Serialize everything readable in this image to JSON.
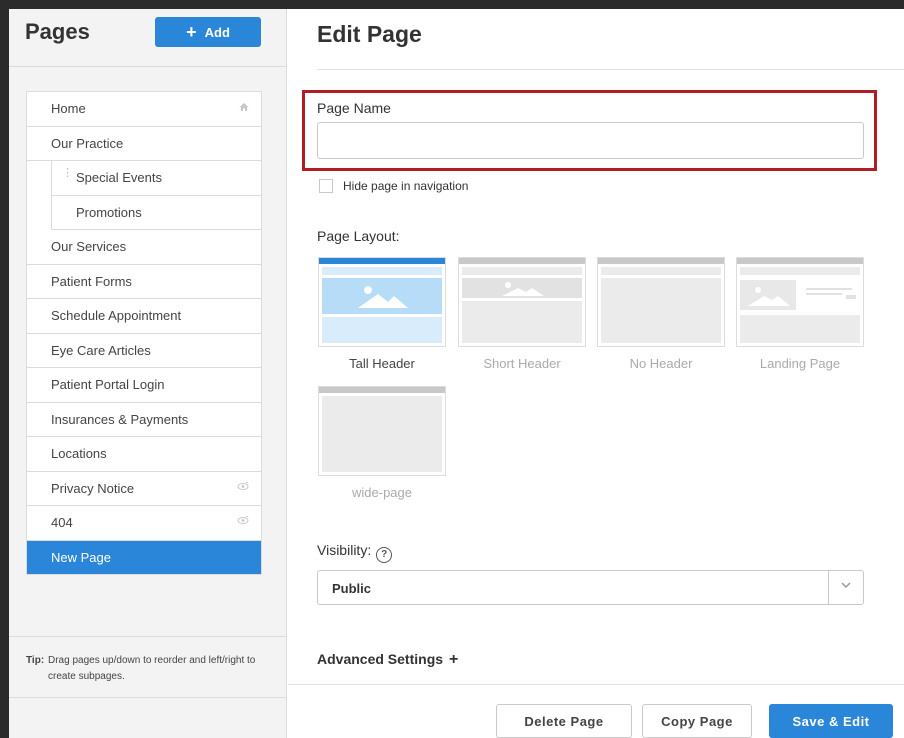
{
  "sidebar": {
    "title": "Pages",
    "add_label": "Add",
    "pages": [
      {
        "label": "Home",
        "icon": "home-icon"
      },
      {
        "label": "Our Practice"
      },
      {
        "label": "Special Events"
      },
      {
        "label": "Promotions"
      },
      {
        "label": "Our Services"
      },
      {
        "label": "Patient Forms"
      },
      {
        "label": "Schedule Appointment"
      },
      {
        "label": "Eye Care Articles"
      },
      {
        "label": "Patient Portal Login"
      },
      {
        "label": "Insurances & Payments"
      },
      {
        "label": "Locations"
      },
      {
        "label": "Privacy Notice",
        "icon": "hidden-eye-icon"
      },
      {
        "label": "404",
        "icon": "hidden-eye-icon"
      },
      {
        "label": "New Page"
      }
    ],
    "tip_label": "Tip:",
    "tip_text": "Drag pages up/down to reorder and left/right to create subpages."
  },
  "main": {
    "title": "Edit Page",
    "page_name_label": "Page Name",
    "page_name_value": "",
    "hide_label": "Hide page in navigation",
    "layout_label": "Page Layout:",
    "layouts": [
      {
        "label": "Tall Header"
      },
      {
        "label": "Short Header"
      },
      {
        "label": "No Header"
      },
      {
        "label": "Landing Page"
      },
      {
        "label": "wide-page"
      }
    ],
    "visibility_label": "Visibility:",
    "visibility_help": "?",
    "visibility_value": "Public",
    "advanced_label": "Advanced Settings",
    "advanced_plus": "+"
  },
  "footer": {
    "delete_label": "Delete Page",
    "copy_label": "Copy Page",
    "save_label": "Save & Edit"
  },
  "colors": {
    "accent": "#2a86d8",
    "highlight": "#b01e23"
  }
}
